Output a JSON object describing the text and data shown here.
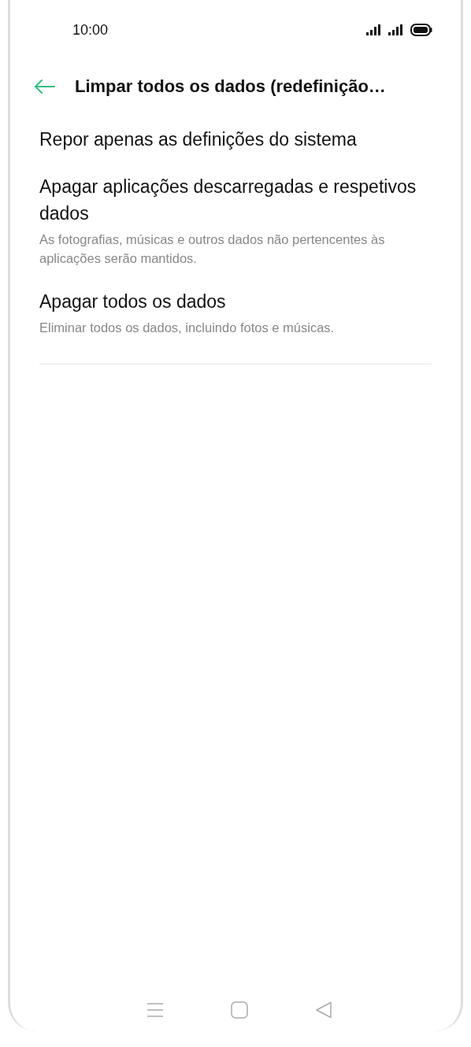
{
  "status_bar": {
    "time": "10:00"
  },
  "header": {
    "title": "Limpar todos os dados (redefinição…"
  },
  "options": [
    {
      "title": "Repor apenas as definições do sistema"
    },
    {
      "title": "Apagar aplicações descarregadas e respetivos dados",
      "description": "As fotografias, músicas e outros dados não pertencentes às aplicações serão mantidos."
    },
    {
      "title": "Apagar todos os dados",
      "description": "Eliminar todos os dados, incluindo fotos e músicas."
    }
  ]
}
